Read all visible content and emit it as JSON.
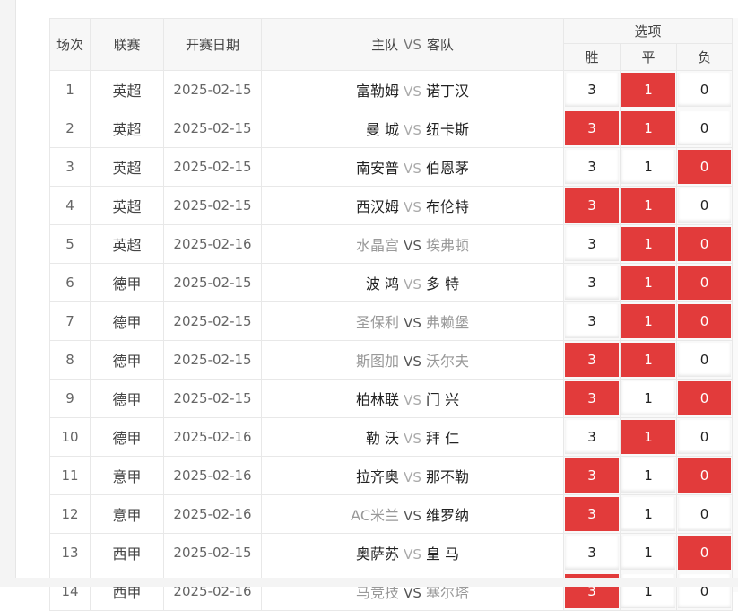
{
  "header": {
    "index": "场次",
    "league": "联赛",
    "date": "开赛日期",
    "home": "主队",
    "vs": "VS",
    "away": "客队",
    "options": "选项",
    "win": "胜",
    "draw": "平",
    "lose": "负"
  },
  "colors": {
    "selected": "#e23b3b",
    "dim_team": "#999999"
  },
  "rows": [
    {
      "idx": "1",
      "league": "英超",
      "date": "2025-02-15",
      "home": "富勒姆",
      "away": "诺丁汉",
      "vs_dim": true,
      "home_dim": false,
      "away_dim": false,
      "win": "3",
      "draw": "1",
      "lose": "0",
      "sel": [
        false,
        true,
        false
      ]
    },
    {
      "idx": "2",
      "league": "英超",
      "date": "2025-02-15",
      "home": "曼 城",
      "away": "纽卡斯",
      "vs_dim": true,
      "home_dim": false,
      "away_dim": false,
      "win": "3",
      "draw": "1",
      "lose": "0",
      "sel": [
        true,
        true,
        false
      ]
    },
    {
      "idx": "3",
      "league": "英超",
      "date": "2025-02-15",
      "home": "南安普",
      "away": "伯恩茅",
      "vs_dim": true,
      "home_dim": false,
      "away_dim": false,
      "win": "3",
      "draw": "1",
      "lose": "0",
      "sel": [
        false,
        false,
        true
      ]
    },
    {
      "idx": "4",
      "league": "英超",
      "date": "2025-02-15",
      "home": "西汉姆",
      "away": "布伦特",
      "vs_dim": true,
      "home_dim": false,
      "away_dim": false,
      "win": "3",
      "draw": "1",
      "lose": "0",
      "sel": [
        true,
        true,
        false
      ]
    },
    {
      "idx": "5",
      "league": "英超",
      "date": "2025-02-16",
      "home": "水晶宫",
      "away": "埃弗顿",
      "vs_dim": false,
      "home_dim": true,
      "away_dim": true,
      "win": "3",
      "draw": "1",
      "lose": "0",
      "sel": [
        false,
        true,
        true
      ]
    },
    {
      "idx": "6",
      "league": "德甲",
      "date": "2025-02-15",
      "home": "波 鸿",
      "away": "多 特",
      "vs_dim": true,
      "home_dim": false,
      "away_dim": false,
      "win": "3",
      "draw": "1",
      "lose": "0",
      "sel": [
        false,
        true,
        true
      ]
    },
    {
      "idx": "7",
      "league": "德甲",
      "date": "2025-02-15",
      "home": "圣保利",
      "away": "弗赖堡",
      "vs_dim": false,
      "home_dim": true,
      "away_dim": true,
      "win": "3",
      "draw": "1",
      "lose": "0",
      "sel": [
        false,
        true,
        true
      ]
    },
    {
      "idx": "8",
      "league": "德甲",
      "date": "2025-02-15",
      "home": "斯图加",
      "away": "沃尔夫",
      "vs_dim": false,
      "home_dim": true,
      "away_dim": true,
      "win": "3",
      "draw": "1",
      "lose": "0",
      "sel": [
        true,
        true,
        false
      ]
    },
    {
      "idx": "9",
      "league": "德甲",
      "date": "2025-02-15",
      "home": "柏林联",
      "away": "门 兴",
      "vs_dim": true,
      "home_dim": false,
      "away_dim": false,
      "win": "3",
      "draw": "1",
      "lose": "0",
      "sel": [
        true,
        false,
        true
      ]
    },
    {
      "idx": "10",
      "league": "德甲",
      "date": "2025-02-16",
      "home": "勒 沃",
      "away": "拜 仁",
      "vs_dim": true,
      "home_dim": false,
      "away_dim": false,
      "win": "3",
      "draw": "1",
      "lose": "0",
      "sel": [
        false,
        true,
        false
      ]
    },
    {
      "idx": "11",
      "league": "意甲",
      "date": "2025-02-16",
      "home": "拉齐奥",
      "away": "那不勒",
      "vs_dim": true,
      "home_dim": false,
      "away_dim": false,
      "win": "3",
      "draw": "1",
      "lose": "0",
      "sel": [
        true,
        false,
        true
      ]
    },
    {
      "idx": "12",
      "league": "意甲",
      "date": "2025-02-16",
      "home": "AC米兰",
      "away": "维罗纳",
      "vs_dim": false,
      "home_dim": true,
      "away_dim": false,
      "win": "3",
      "draw": "1",
      "lose": "0",
      "sel": [
        true,
        false,
        false
      ]
    },
    {
      "idx": "13",
      "league": "西甲",
      "date": "2025-02-15",
      "home": "奥萨苏",
      "away": "皇 马",
      "vs_dim": true,
      "home_dim": false,
      "away_dim": false,
      "win": "3",
      "draw": "1",
      "lose": "0",
      "sel": [
        false,
        false,
        true
      ]
    },
    {
      "idx": "14",
      "league": "西甲",
      "date": "2025-02-16",
      "home": "马竞技",
      "away": "塞尔塔",
      "vs_dim": false,
      "home_dim": true,
      "away_dim": true,
      "win": "3",
      "draw": "1",
      "lose": "0",
      "sel": [
        true,
        false,
        false
      ]
    }
  ]
}
